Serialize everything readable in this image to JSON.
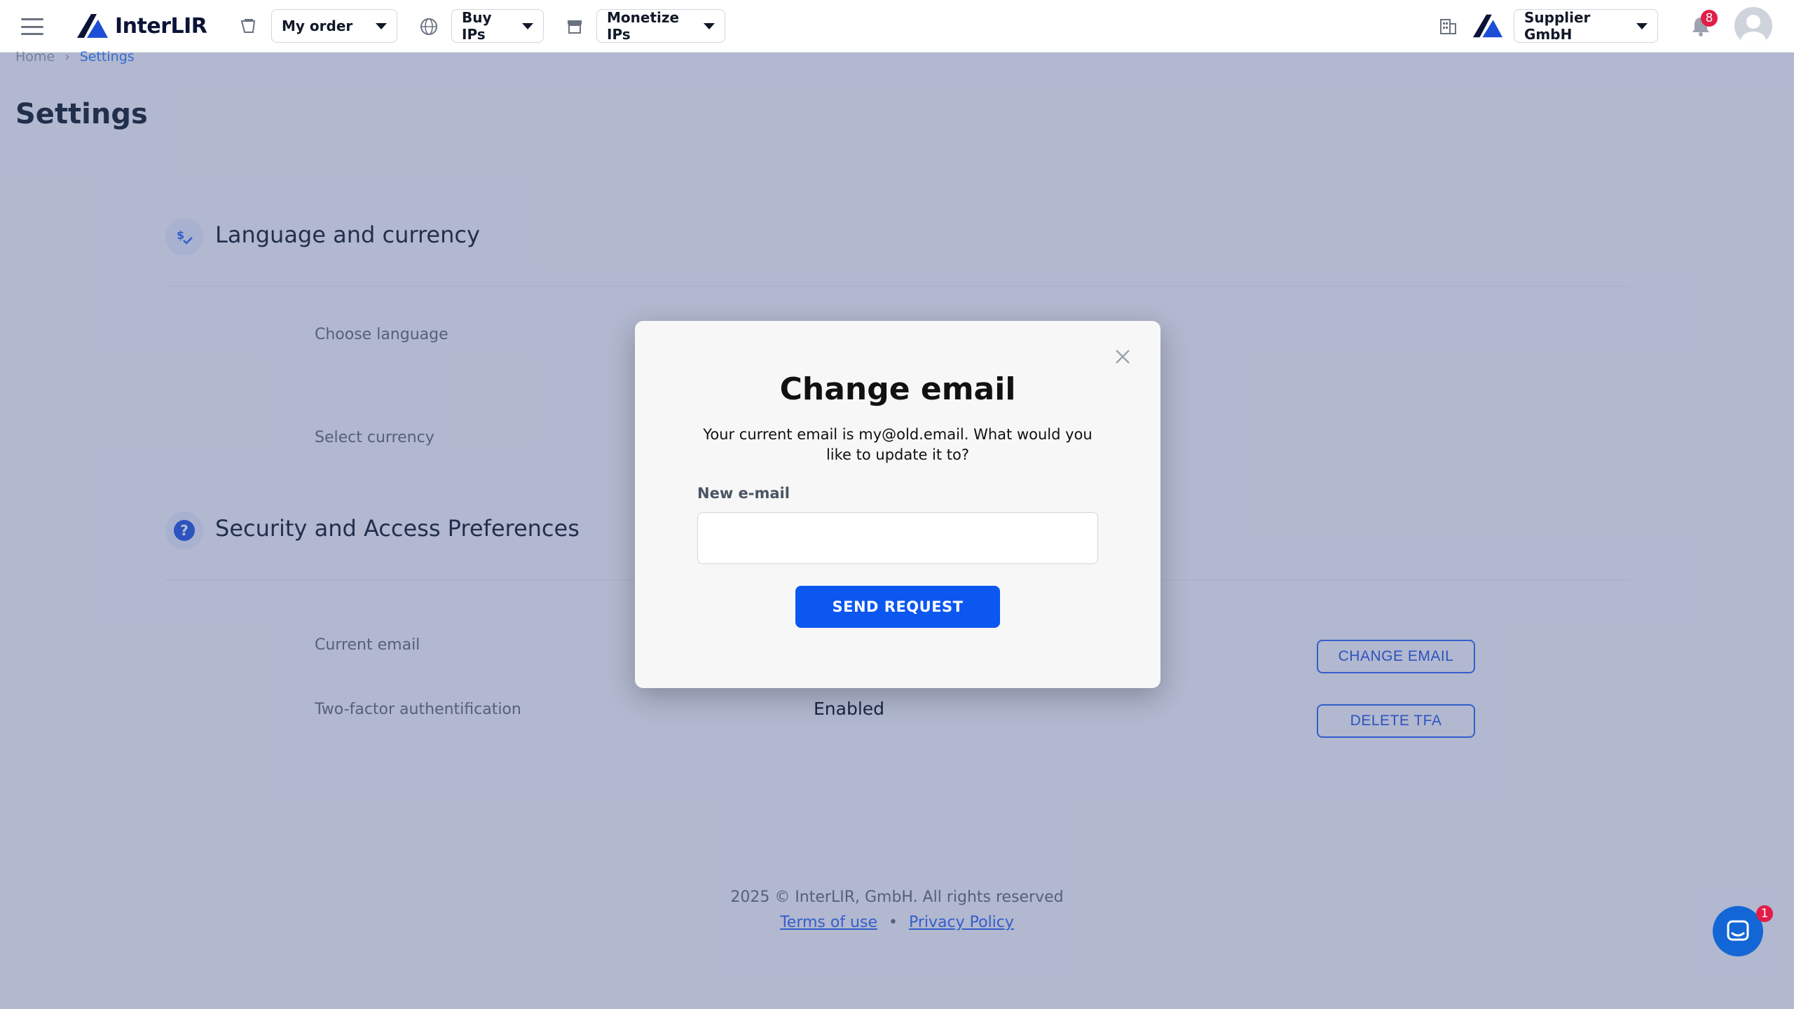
{
  "header": {
    "logo_text": "InterLIR",
    "my_order_label": "My order",
    "buy_ips_label": "Buy IPs",
    "monetize_ips_label": "Monetize IPs",
    "company_label": "Supplier GmbH",
    "notification_count": "8"
  },
  "breadcrumb": {
    "home": "Home",
    "current": "Settings"
  },
  "page": {
    "title": "Settings"
  },
  "sections": {
    "language": {
      "title": "Language and currency",
      "choose_language_label": "Choose language",
      "select_currency_label": "Select currency"
    },
    "security": {
      "title": "Security and Access Preferences",
      "current_email_label": "Current email",
      "tfa_label": "Two-factor authentification",
      "tfa_status": "Enabled",
      "change_email_button": "CHANGE EMAIL",
      "delete_tfa_button": "DELETE TFA"
    }
  },
  "footer": {
    "copyright": "2025 © InterLIR, GmbH. All rights reserved",
    "terms_link": "Terms of use",
    "privacy_link": "Privacy Policy",
    "separator": "•"
  },
  "chat": {
    "unread_count": "1"
  },
  "modal": {
    "title": "Change email",
    "description": "Your current email is my@old.email. What would you like to update it to?",
    "field_label": "New e-mail",
    "field_value": "",
    "field_placeholder": "",
    "submit_label": "SEND REQUEST"
  },
  "colors": {
    "primary": "#0b57f0",
    "accent_outline": "#3b6ff5",
    "badge": "#e11d48",
    "overlay": "rgba(44, 62, 120, 0.33)"
  },
  "icons": {
    "menu": "hamburger-icon",
    "order": "cart-icon",
    "buy": "globe-icon",
    "monetize": "store-icon",
    "company": "building-icon",
    "notifications": "bell-icon",
    "language_section": "currency-exchange-icon",
    "security_section": "question-icon",
    "close": "close-icon",
    "chat": "chat-icon"
  }
}
